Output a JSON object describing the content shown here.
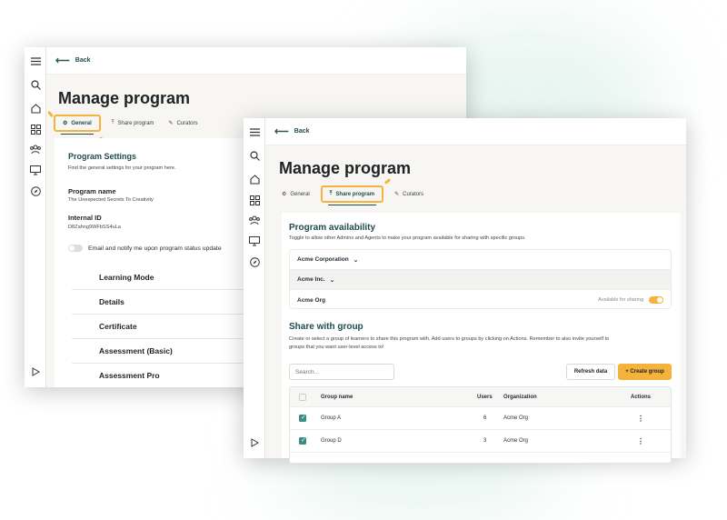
{
  "colors": {
    "accent": "#f5b23c",
    "brand": "#1e4d4b",
    "checkbox": "#3b8b86"
  },
  "back_window": {
    "back_label": "Back",
    "title": "Manage program",
    "tabs": [
      {
        "label": "General",
        "icon": "gear-icon",
        "active": true
      },
      {
        "label": "Share program",
        "icon": "upload-icon"
      },
      {
        "label": "Curators",
        "icon": "pencil-icon"
      }
    ],
    "section_title": "Program Settings",
    "section_desc": "Find the general settings for your program here.",
    "program_name_label": "Program name",
    "program_name_value": "The Unexpected Secrets To Creativity",
    "internal_id_label": "Internal ID",
    "internal_id_value": "D8Zahng9WFbSS4uLa",
    "notify_label": "Email and notify me upon program status update",
    "accordions": [
      "Learning Mode",
      "Details",
      "Certificate",
      "Assessment (Basic)",
      "Assessment Pro"
    ]
  },
  "front_window": {
    "back_label": "Back",
    "title": "Manage program",
    "tabs": [
      {
        "label": "General",
        "icon": "gear-icon"
      },
      {
        "label": "Share program",
        "icon": "upload-icon",
        "active": true
      },
      {
        "label": "Curators",
        "icon": "pencil-icon"
      }
    ],
    "availability_title": "Program availability",
    "availability_desc": "Toggle to allow other Admins and Agents to make your program available for sharing with specific groups.",
    "orgs": [
      {
        "name": "Acme Corporation",
        "expandable": true
      },
      {
        "name": "Acme Inc.",
        "expandable": true
      },
      {
        "name": "Acme Org",
        "status": "Available for sharing",
        "toggle": true
      }
    ],
    "share_title": "Share with group",
    "share_desc_line1": "Create or select a group of learners to share this program with. Add users to groups by clicking on Actions. Remember to also invite yourself to",
    "share_desc_line2": "groups that you want user-level access to!",
    "search_placeholder": "Search...",
    "refresh_label": "Refresh data",
    "create_label": "+ Create group",
    "table_headers": [
      "Group name",
      "Users",
      "Organization",
      "Actions"
    ],
    "rows": [
      {
        "group": "Group A",
        "users": "6",
        "org": "Acme Org",
        "checked": true
      },
      {
        "group": "Group D",
        "users": "3",
        "org": "Acme Org",
        "checked": true
      }
    ]
  }
}
